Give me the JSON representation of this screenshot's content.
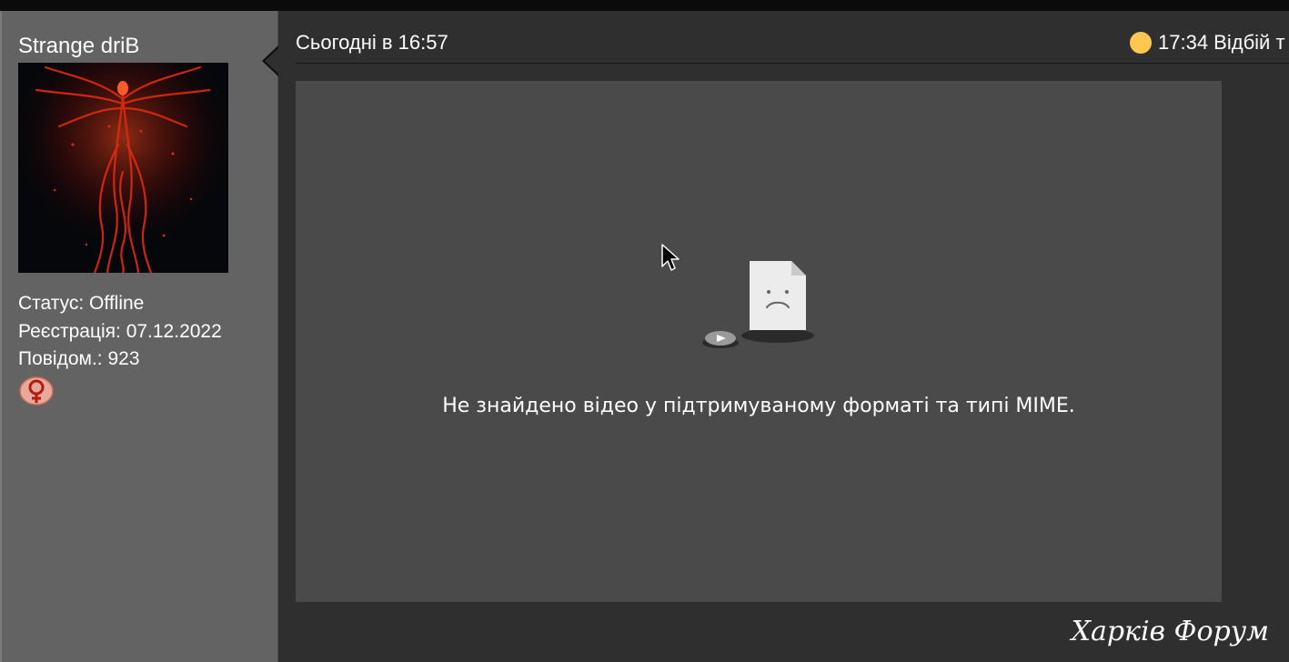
{
  "user": {
    "name": "Strange driB",
    "status": "Статус: Offline",
    "registration": "Реєстрація: 07.12.2022",
    "posts": "Повідом.: 923"
  },
  "post": {
    "date": "Сьогодні в 16:57",
    "reply_time": "17:34 Відбій т"
  },
  "video": {
    "error_message": "Не знайдено відео у підтримуваному форматі та типі MIME."
  },
  "footer": {
    "logo": "Харків Форум"
  },
  "colors": {
    "status_dot": "#ffc74d",
    "sidebar": "#636363",
    "content": "#2f2f2f",
    "video_bg": "#4a4a4a"
  },
  "icons": {
    "status": "online-dot-icon",
    "rank": "venus-badge-icon",
    "video_error": "broken-video-file-icon"
  }
}
